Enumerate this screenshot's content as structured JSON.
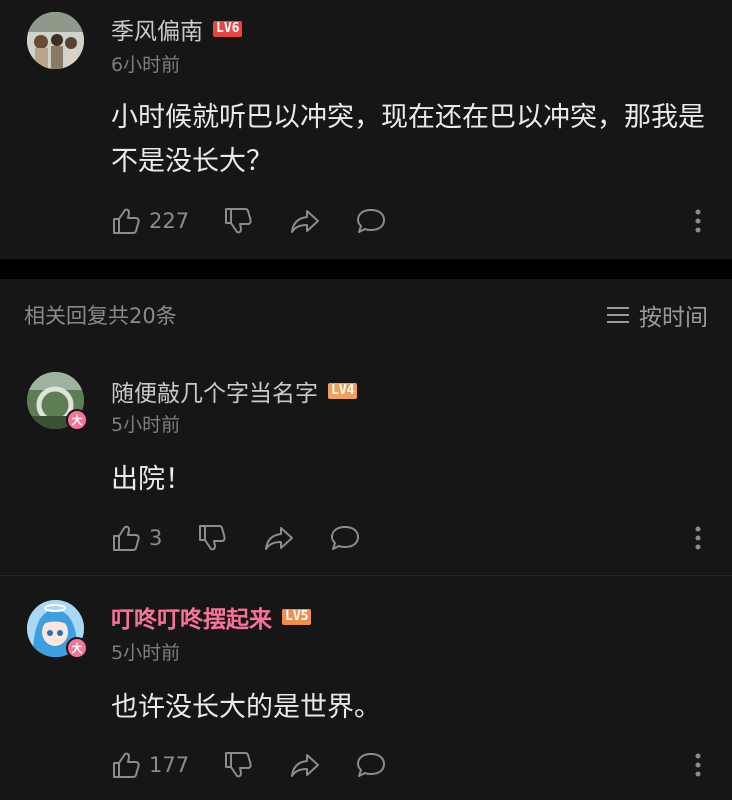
{
  "main_comment": {
    "username": "季风偏南",
    "level": "LV6",
    "level_color": "#e84545",
    "time": "6小时前",
    "content": "小时候就听巴以冲突，现在还在巴以冲突，那我是不是没长大？",
    "likes": "227",
    "avatar_icon": "group-photo-avatar"
  },
  "replies_header": {
    "count_label": "相关回复共20条",
    "sort_label": "按时间",
    "sort_icon": "menu-lines-icon"
  },
  "replies": [
    {
      "username": "随便敲几个字当名字",
      "level": "LV4",
      "level_color": "#f0a05a",
      "time": "5小时前",
      "content": "出院！",
      "likes": "3",
      "badge": "大",
      "vip": false
    },
    {
      "username": "叮咚叮咚摆起来",
      "level": "LV5",
      "level_color": "#f28e4c",
      "time": "5小时前",
      "content": "也许没长大的是世界。",
      "likes": "177",
      "badge": "大",
      "vip": true
    }
  ]
}
